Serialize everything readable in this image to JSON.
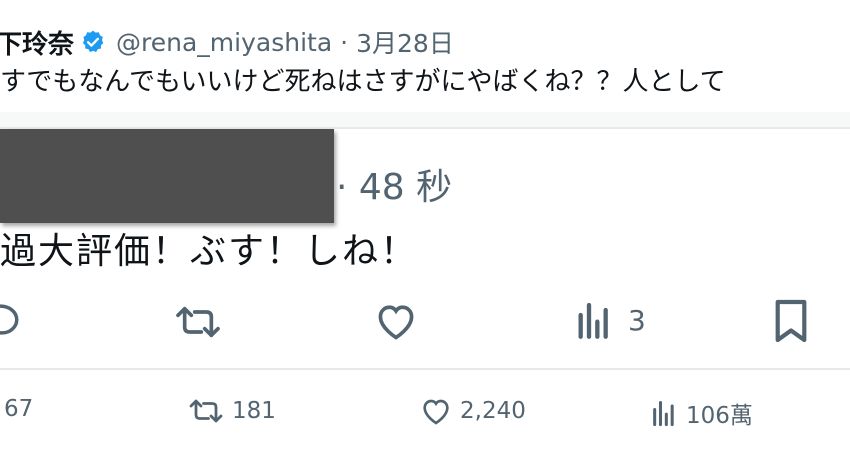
{
  "tweet": {
    "display_name": "下玲奈",
    "handle": "@rena_miyashita",
    "separator": "·",
    "date": "3月28日",
    "text": "すでもなんでもいいけど死ねはさすがにやばくね？？人として"
  },
  "reply": {
    "time": "· 48 秒",
    "text": "過大評価！ぶす！しね！",
    "views": "3"
  },
  "stats": {
    "replies": "67",
    "retweets": "181",
    "likes": "2,240",
    "views": "106萬"
  },
  "colors": {
    "verified": "#1d9bf0",
    "secondary": "#536471",
    "text": "#0f1419"
  }
}
